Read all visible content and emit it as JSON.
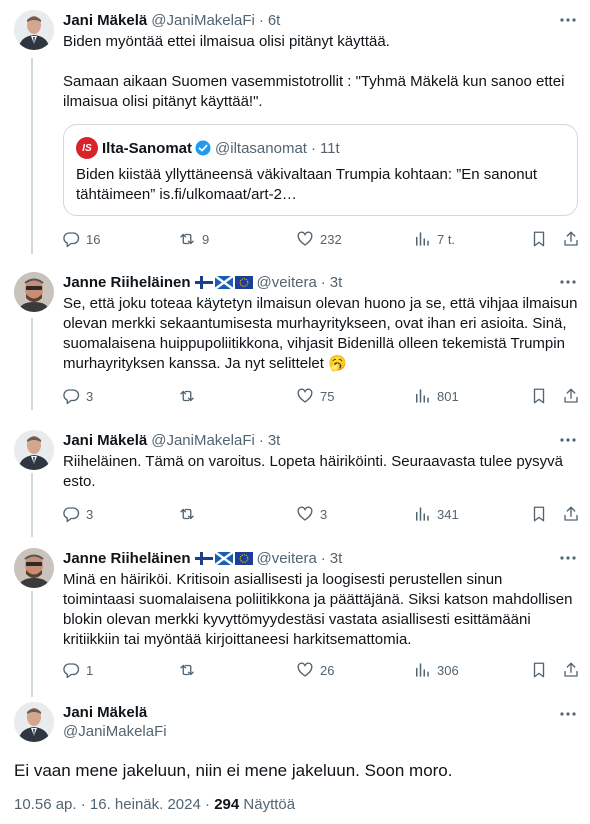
{
  "tweets": [
    {
      "name": "Jani Mäkelä",
      "handle": "@JaniMakelaFi",
      "dot": "·",
      "time": "6t",
      "text": "Biden myöntää ettei ilmaisua olisi pitänyt käyttää.\n\nSamaan aikaan Suomen vasemmistotrollit : \"Tyhmä Mäkelä kun sanoo ettei ilmaisua olisi pitänyt käyttää!\".",
      "quote": {
        "logo": "IS",
        "name": "Ilta-Sanomat",
        "handle": "@iltasanomat",
        "dot": "·",
        "time": "11t",
        "text": "Biden kiistää yllyttäneensä väkivaltaan Trumpia kohtaan: ”En sanonut tähtäimeen” is.fi/ulkomaat/art-2…"
      },
      "actions": {
        "replies": "16",
        "retweets": "9",
        "likes": "232",
        "views": "7 t."
      }
    },
    {
      "name": "Janne Riiheläinen",
      "handle": "@veitera",
      "dot": "·",
      "time": "3t",
      "text": "Se, että joku toteaa käytetyn ilmaisun olevan huono ja se, että vihjaa ilmaisun olevan merkki sekaantumisesta murhayritykseen, ovat ihan eri asioita. Sinä, suomalaisena huippupoliitikkona, vihjasit Bidenillä olleen tekemistä Trumpin murhayrityksen kanssa. Ja nyt selittelet 🥱",
      "actions": {
        "replies": "3",
        "retweets": "",
        "likes": "75",
        "views": "801"
      }
    },
    {
      "name": "Jani Mäkelä",
      "handle": "@JaniMakelaFi",
      "dot": "·",
      "time": "3t",
      "text": "Riiheläinen. Tämä on varoitus. Lopeta häiriköinti. Seuraavasta tulee pysyvä esto.",
      "actions": {
        "replies": "3",
        "retweets": "",
        "likes": "3",
        "views": "341"
      }
    },
    {
      "name": "Janne Riiheläinen",
      "handle": "@veitera",
      "dot": "·",
      "time": "3t",
      "text": "Minä en häiriköi. Kritisoin asiallisesti ja loogisesti perustellen sinun toimintaasi suomalaisena poliitikkona ja päättäjänä. Siksi katson mahdollisen blokin olevan merkki kyvyttömyydestäsi vastata asiallisesti esittämääni kritiikkiin tai myöntää kirjoittaneesi harkitsemattomia.",
      "actions": {
        "replies": "1",
        "retweets": "",
        "likes": "26",
        "views": "306"
      }
    }
  ],
  "main": {
    "name": "Jani Mäkelä",
    "handle": "@JaniMakelaFi",
    "text": "Ei vaan mene jakeluun, niin ei mene jakeluun. Soon moro.",
    "time": "10.56 ap.",
    "date": "16. heinäk. 2024",
    "views_count": "294",
    "views_label": "Näyttöä"
  },
  "colors": {
    "text": "#0f1419",
    "muted": "#536471",
    "border": "#cfd9de",
    "verified": "#1d9bf0",
    "is_logo": "#d8232a"
  }
}
